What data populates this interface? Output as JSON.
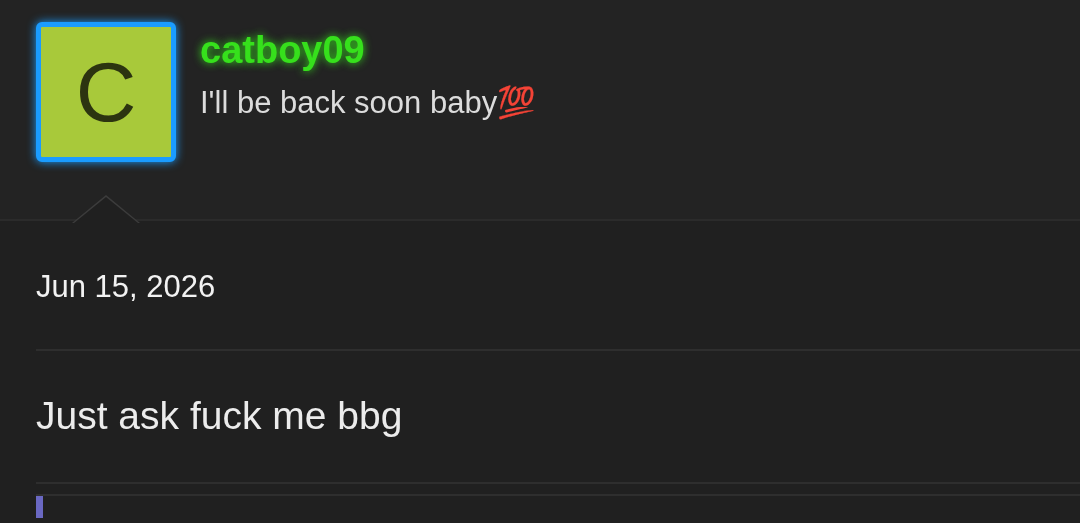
{
  "profile": {
    "avatar_letter": "C",
    "username": "catboy09",
    "status": "I'll be back soon baby💯"
  },
  "post": {
    "date": "Jun 15, 2026",
    "message": "Just ask fuck me bbg"
  }
}
